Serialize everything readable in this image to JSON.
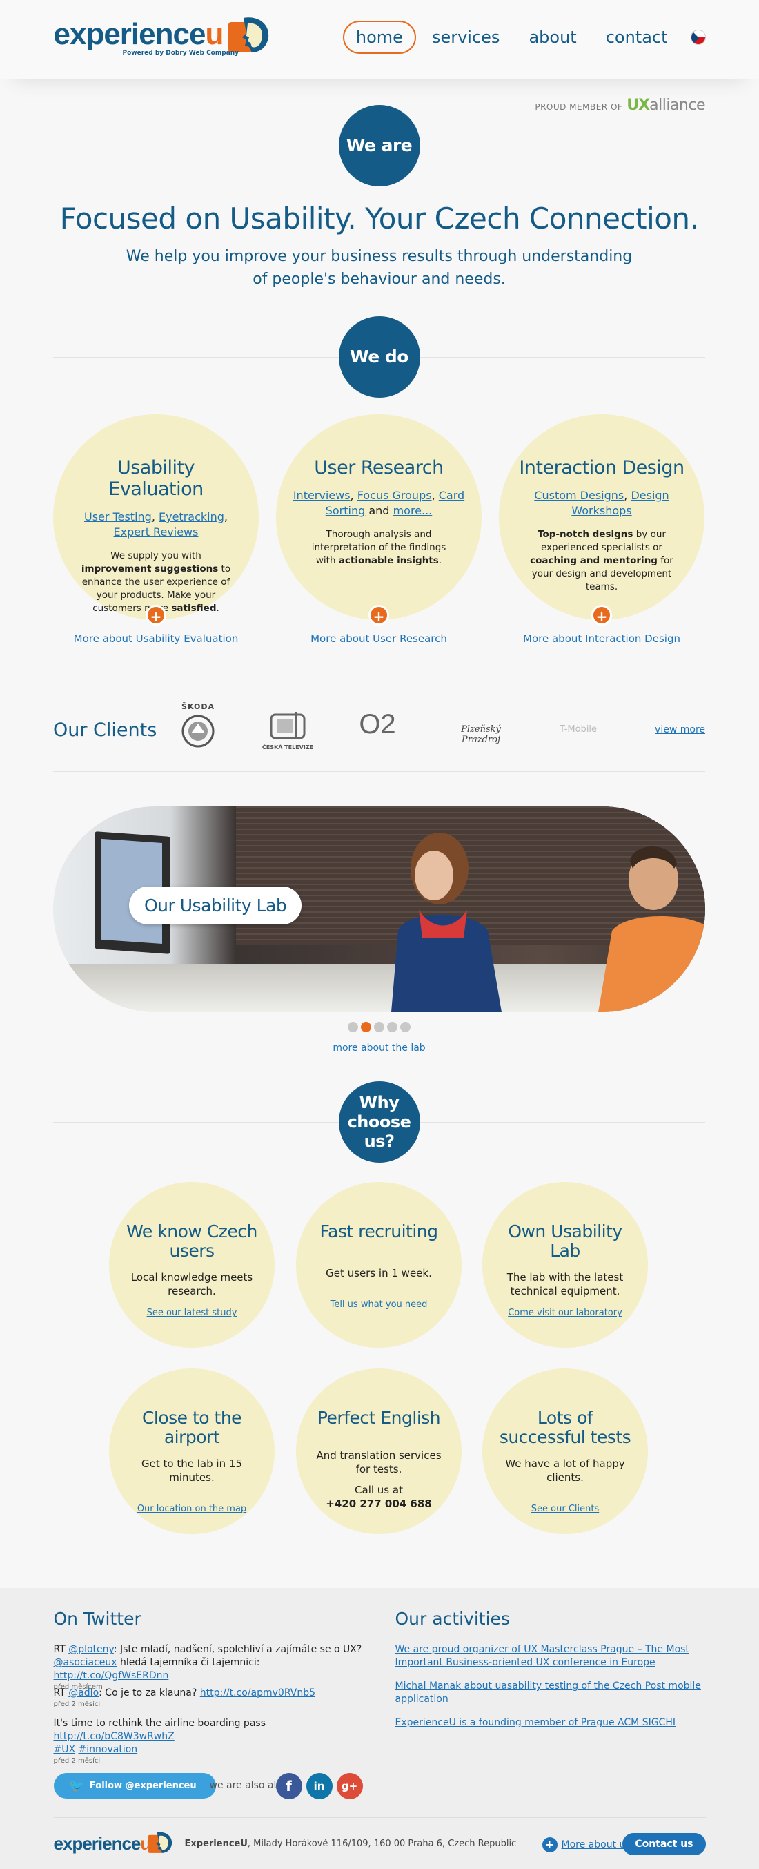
{
  "header": {
    "logo_main": "experience",
    "logo_u": "u",
    "logo_sub": "Powered by Dobry Web Company",
    "nav": [
      {
        "label": "home"
      },
      {
        "label": "services"
      },
      {
        "label": "about"
      },
      {
        "label": "contact"
      }
    ],
    "uxalliance": {
      "prefix": "PROUD MEMBER OF",
      "ux": "UX",
      "alliance": "alliance"
    }
  },
  "we_are": {
    "circle": "We are",
    "title": "Focused on Usability. Your Czech Connection.",
    "subtitle": "We help you improve your business results through understanding of people's behaviour and needs."
  },
  "we_do": {
    "circle": "We do",
    "services": [
      {
        "title": "Usability Evaluation",
        "links": [
          "User Testing",
          "Eyetracking",
          "Expert Reviews"
        ],
        "desc_1": "We supply you with ",
        "desc_b1": "improvement suggestions",
        "desc_2": " to enhance the user experience of your products. Make your customers more ",
        "desc_b2": "satisfied",
        "desc_3": ".",
        "more": "More about Usability Evaluation"
      },
      {
        "title": "User Research",
        "links": [
          "Interviews",
          "Focus Groups",
          "Card Sorting",
          "more..."
        ],
        "and": "and",
        "desc_1": "Thorough analysis and interpretation of the findings with ",
        "desc_b1": "actionable insights",
        "desc_2": ".",
        "more": "More about User Research"
      },
      {
        "title": "Interaction Design",
        "links": [
          "Custom Designs",
          "Design Workshops"
        ],
        "desc_b1": "Top-notch designs",
        "desc_1": " by our experienced specialists or ",
        "desc_b2": "coaching and mentoring",
        "desc_2": " for your design and development teams.",
        "more": "More about Interaction Design"
      }
    ]
  },
  "clients": {
    "title": "Our Clients",
    "logos": [
      "ŠKODA",
      "ČESKÁ TELEVIZE",
      "O2",
      "Plzeňský Prazdroj",
      "T-Mobile"
    ],
    "view_more": "view more"
  },
  "lab": {
    "label": "Our Usability Lab",
    "active_slide": 2,
    "slide_count": 5,
    "link": "more about the lab"
  },
  "why": {
    "circle": "Why choose us?",
    "items": [
      {
        "title": "We know Czech users",
        "desc": "Local knowledge meets research.",
        "link": "See our latest study"
      },
      {
        "title": "Fast recruiting",
        "desc": "Get users in 1 week.",
        "link": "Tell us what you need"
      },
      {
        "title": "Own Usability Lab",
        "desc": "The lab with the latest technical equipment.",
        "link": "Come visit our laboratory"
      },
      {
        "title": "Close to the airport",
        "desc": "Get to the lab in 15 minutes.",
        "link": "Our location on the map"
      },
      {
        "title": "Perfect English",
        "desc": "And translation services for tests.",
        "phone_label": "Call us at",
        "phone": "+420 277 004 688"
      },
      {
        "title": "Lots of successful tests",
        "desc": "We have a lot of happy clients.",
        "link": "See our Clients"
      }
    ]
  },
  "footer": {
    "twitter_title": "On Twitter",
    "tweets": [
      {
        "pre": "RT ",
        "h1": "@ploteny",
        "t1": ": Jste mladí, nadšení, spolehliví a zajímáte se o UX? ",
        "h2": "@asociaceux",
        "t2": " hledá tajemníka či tajemnici: ",
        "url": "http://t.co/QgfWsERDnn",
        "when": "před měsícem"
      },
      {
        "pre": "RT ",
        "h1": "@adlo",
        "t1": ": Co je to za klauna? ",
        "url": "http://t.co/apmv0RVnb5",
        "when": "před 2 měsíci"
      },
      {
        "pre": "It's time to rethink the airline boarding pass ",
        "url": "http://t.co/bC8W3wRwhZ",
        "tag1": "#UX",
        "tag2": "#innovation",
        "when": "před 2 měsíci"
      }
    ],
    "activities_title": "Our activities",
    "activities": [
      "We are proud organizer of UX Masterclass Prague – The Most Important Business-oriented UX conference in Europe",
      "Michal Manak about uasability testing of the Czech Post mobile application",
      "ExperienceU is a founding member of Prague ACM SIGCHI"
    ],
    "follow": "Follow @experienceu",
    "also": "we are also at",
    "social": [
      "f",
      "in",
      "g+"
    ],
    "address_company": "ExperienceU",
    "address": ", Milady Horákové 116/109, 160 00 Praha 6, Czech Republic",
    "more_about": "More about us",
    "contact": "Contact us"
  },
  "colors": {
    "brand_blue": "#145b87",
    "accent_orange": "#e86a1c",
    "circle_cream": "#f4efc7",
    "link_blue": "#1d72b8"
  }
}
